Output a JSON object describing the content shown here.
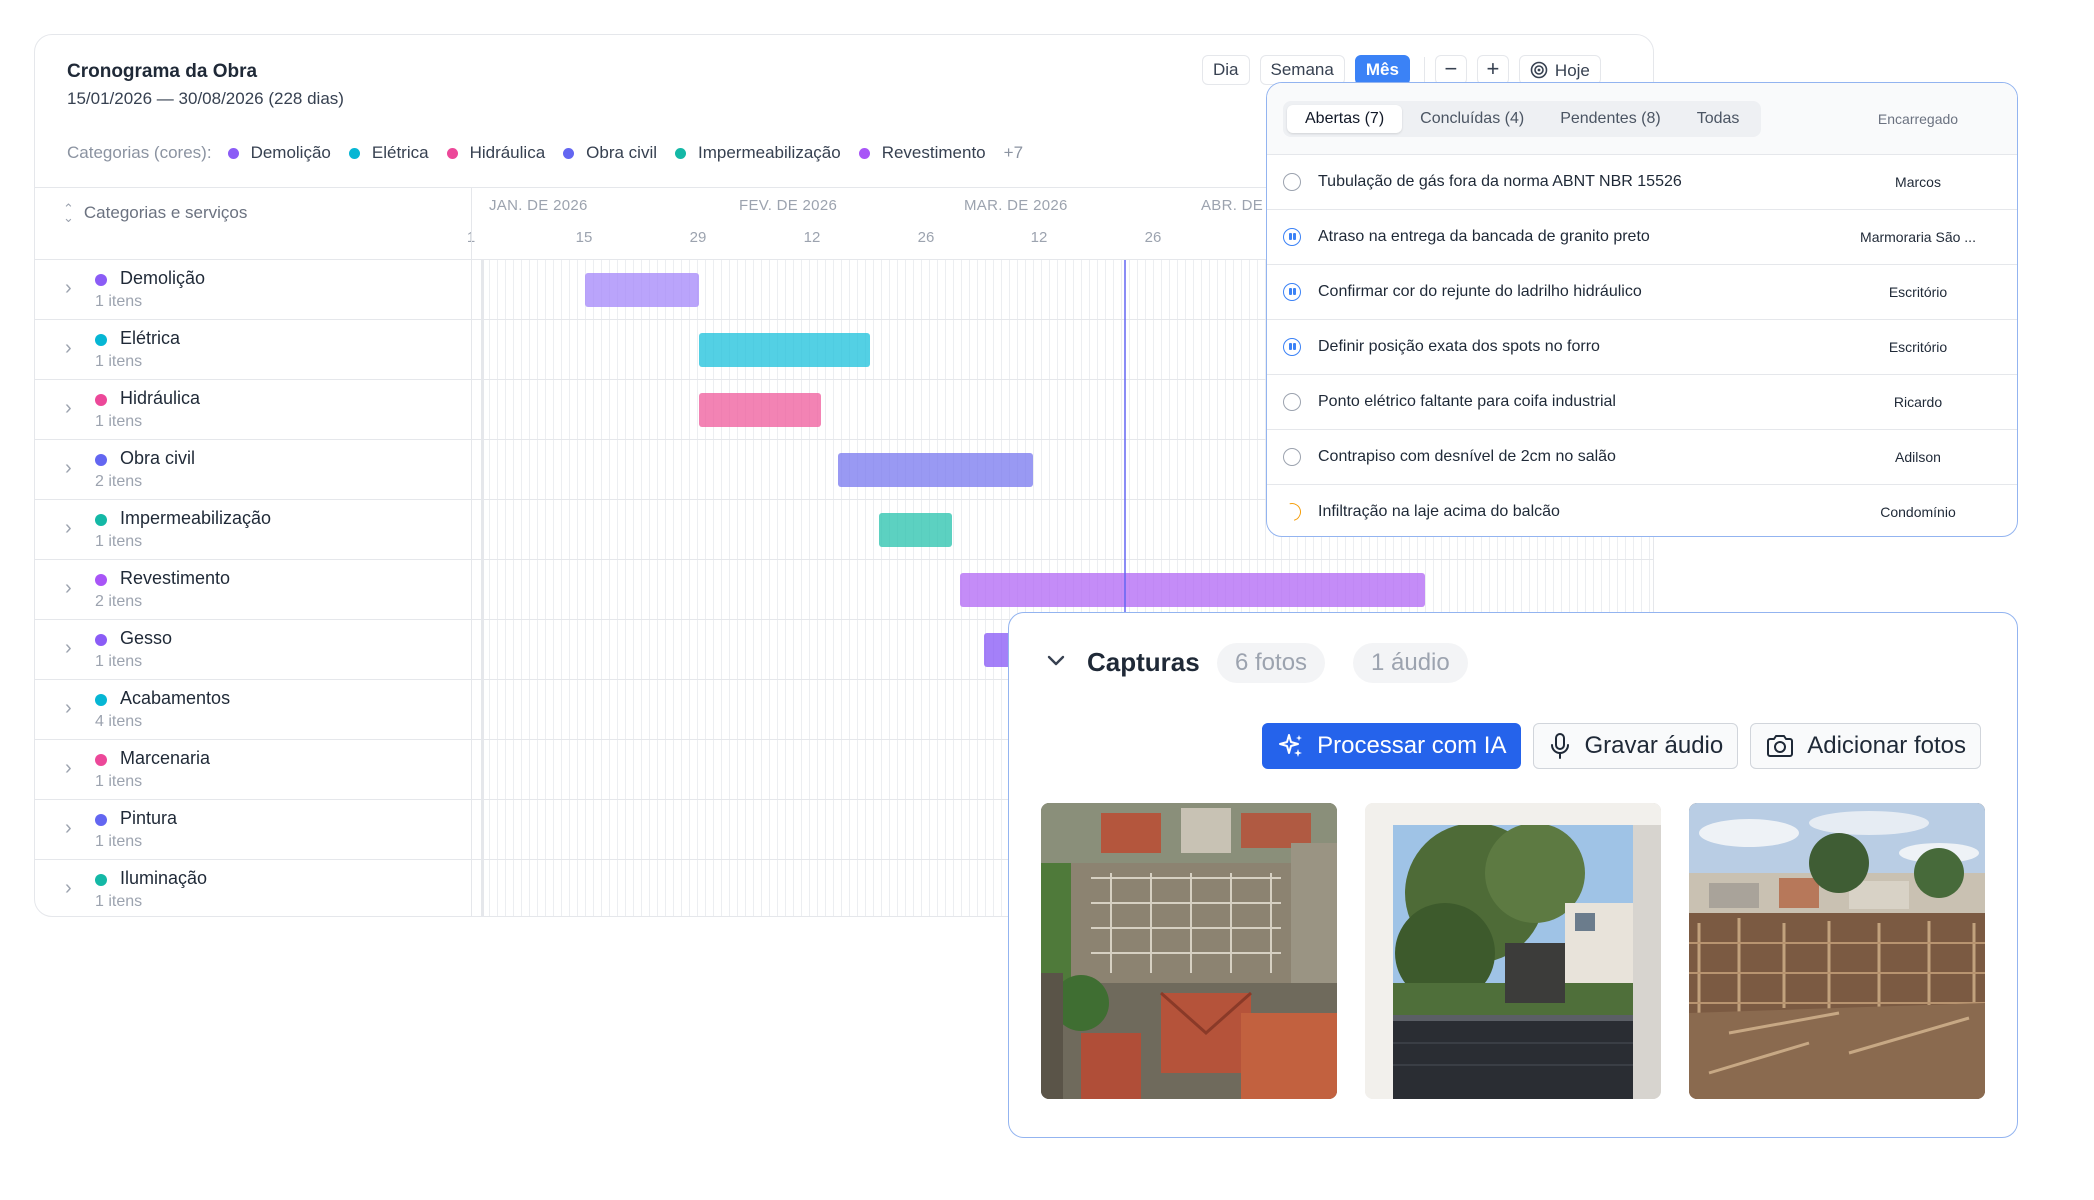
{
  "gantt": {
    "title": "Cronograma da Obra",
    "date_range": "15/01/2026 — 30/08/2026 (228 dias)",
    "legend_label": "Categorias (cores):",
    "legend": [
      {
        "label": "Demolição",
        "color": "#8b5cf6"
      },
      {
        "label": "Elétrica",
        "color": "#06b6d4"
      },
      {
        "label": "Hidráulica",
        "color": "#ec4899"
      },
      {
        "label": "Obra civil",
        "color": "#6366f1"
      },
      {
        "label": "Impermeabilização",
        "color": "#14b8a6"
      },
      {
        "label": "Revestimento",
        "color": "#a855f7"
      }
    ],
    "legend_more": "+7",
    "view_buttons": {
      "day": "Dia",
      "week": "Semana",
      "month": "Mês",
      "today": "Hoje",
      "zoom_out": "−",
      "zoom_in": "+"
    },
    "column_header": "Categorias e serviços",
    "months": [
      "JAN. DE 2026",
      "FEV. DE 2026",
      "MAR. DE 2026",
      "ABR. DE"
    ],
    "days": [
      "1",
      "15",
      "29",
      "12",
      "26",
      "12",
      "26"
    ],
    "rows": [
      {
        "name": "Demolição",
        "count": "1 itens",
        "color": "#8b5cf6"
      },
      {
        "name": "Elétrica",
        "count": "1 itens",
        "color": "#06b6d4"
      },
      {
        "name": "Hidráulica",
        "count": "1 itens",
        "color": "#ec4899"
      },
      {
        "name": "Obra civil",
        "count": "2 itens",
        "color": "#6366f1"
      },
      {
        "name": "Impermeabilização",
        "count": "1 itens",
        "color": "#14b8a6"
      },
      {
        "name": "Revestimento",
        "count": "2 itens",
        "color": "#a855f7"
      },
      {
        "name": "Gesso",
        "count": "1 itens",
        "color": "#8b5cf6"
      },
      {
        "name": "Acabamentos",
        "count": "4 itens",
        "color": "#06b6d4"
      },
      {
        "name": "Marcenaria",
        "count": "1 itens",
        "color": "#ec4899"
      },
      {
        "name": "Pintura",
        "count": "1 itens",
        "color": "#6366f1"
      },
      {
        "name": "Iluminação",
        "count": "1 itens",
        "color": "#14b8a6"
      }
    ],
    "bars": [
      {
        "row": "Demolição",
        "start": "2026-01-15",
        "end": "2026-01-29",
        "color": "#a78bfa"
      },
      {
        "row": "Elétrica",
        "start": "2026-01-29",
        "end": "2026-02-19",
        "color": "#22c3dd"
      },
      {
        "row": "Hidráulica",
        "start": "2026-01-29",
        "end": "2026-02-13",
        "color": "#f0609f"
      },
      {
        "row": "Obra civil",
        "start": "2026-02-15",
        "end": "2026-03-11",
        "color": "#7c7cf0"
      },
      {
        "row": "Impermeabilização",
        "start": "2026-02-20",
        "end": "2026-03-01",
        "color": "#2ec4b0"
      },
      {
        "row": "Revestimento",
        "start": "2026-03-02",
        "end": "2026-04-28",
        "color": "#b36cf5"
      },
      {
        "row": "Gesso",
        "start": "2026-03-05",
        "end": "",
        "color": "#8b5cf6"
      }
    ]
  },
  "issues": {
    "tabs": [
      "Abertas (7)",
      "Concluídas (4)",
      "Pendentes (8)",
      "Todas"
    ],
    "owner_header": "Encarregado",
    "rows": [
      {
        "title": "Tubulação de gás fora da norma ABNT NBR 15526",
        "owner": "Marcos",
        "status": "open"
      },
      {
        "title": "Atraso na entrega da bancada de granito preto",
        "owner": "Marmoraria São ...",
        "status": "in-progress"
      },
      {
        "title": "Confirmar cor do rejunte do ladrilho hidráulico",
        "owner": "Escritório",
        "status": "in-progress"
      },
      {
        "title": "Definir posição exata dos spots no forro",
        "owner": "Escritório",
        "status": "in-progress"
      },
      {
        "title": "Ponto elétrico faltante para coifa industrial",
        "owner": "Ricardo",
        "status": "open"
      },
      {
        "title": "Contrapiso com desnível de 2cm no salão",
        "owner": "Adilson",
        "status": "open"
      },
      {
        "title": "Infiltração na laje acima do balcão",
        "owner": "Condomínio",
        "status": "warning"
      }
    ]
  },
  "captures": {
    "title": "Capturas",
    "photos_badge": "6 fotos",
    "audio_badge": "1 áudio",
    "process_label": "Processar com IA",
    "record_label": "Gravar áudio",
    "add_photos_label": "Adicionar fotos"
  }
}
